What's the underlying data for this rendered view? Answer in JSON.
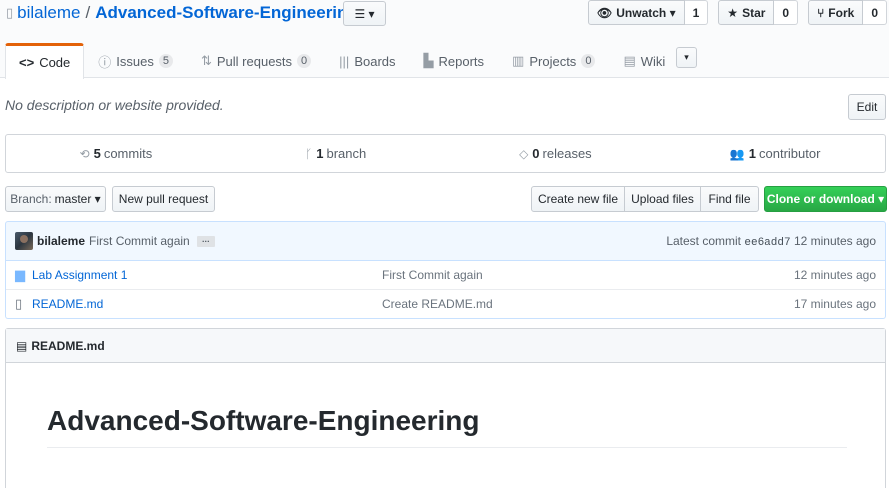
{
  "repo": {
    "owner": "bilaleme",
    "separator": "/",
    "name": "Advanced-Software-Engineering",
    "list_button": "☰ ▾"
  },
  "actions": {
    "watch": {
      "label": "Unwatch ▾",
      "count": "1"
    },
    "star": {
      "label": "Star",
      "count": "0"
    },
    "fork": {
      "label": "Fork",
      "count": "0"
    }
  },
  "nav": {
    "code": "Code",
    "issues": {
      "label": "Issues",
      "count": "5"
    },
    "pulls": {
      "label": "Pull requests",
      "count": "0"
    },
    "boards": "Boards",
    "reports": "Reports",
    "projects": {
      "label": "Projects",
      "count": "0"
    },
    "wiki": "Wiki",
    "more": "▾"
  },
  "description": {
    "text": "No description or website provided.",
    "edit": "Edit"
  },
  "summary": {
    "commits": {
      "count": "5",
      "label": "commits"
    },
    "branches": {
      "count": "1",
      "label": "branch"
    },
    "releases": {
      "count": "0",
      "label": "releases"
    },
    "contributors": {
      "count": "1",
      "label": "contributor"
    }
  },
  "filenav": {
    "branch_prefix": "Branch:",
    "branch_name": "master ▾",
    "new_pr": "New pull request",
    "create_file": "Create new file",
    "upload_files": "Upload files",
    "find_file": "Find file",
    "clone": "Clone or download ▾"
  },
  "commit": {
    "author": "bilaleme",
    "message": "First Commit again",
    "ellipsis": "…",
    "latest_label": "Latest commit",
    "sha": "ee6add7",
    "age": "12 minutes ago"
  },
  "files": [
    {
      "name": "Lab Assignment 1",
      "message": "First Commit again",
      "age": "12 minutes ago"
    },
    {
      "name": "README.md",
      "message": "Create README.md",
      "age": "17 minutes ago"
    }
  ],
  "readme": {
    "filename": "README.md",
    "heading": "Advanced-Software-Engineering"
  }
}
